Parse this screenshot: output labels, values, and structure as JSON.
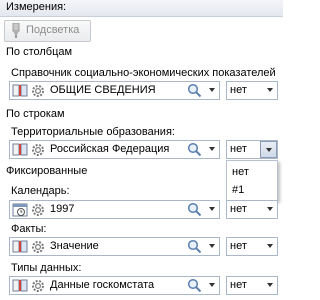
{
  "panel": {
    "title": "Измерения:"
  },
  "toolbar": {
    "highlight_label": "Подсветка"
  },
  "columns": {
    "title": "По столбцам",
    "items": [
      {
        "label": "Справочник социально-экономических показателей",
        "value": "ОБЩИЕ СВЕДЕНИЯ",
        "option": "нет"
      }
    ]
  },
  "rows": {
    "title": "По строкам",
    "items": [
      {
        "label": "Территориальные образования:",
        "value": "Российская Федерация",
        "option": "нет"
      }
    ]
  },
  "option_dropdown": {
    "options": [
      "нет",
      "#1"
    ]
  },
  "fixed": {
    "title": "Фиксированные",
    "items": [
      {
        "label": "Календарь:",
        "value": "1997",
        "option": "нет"
      },
      {
        "label": "Факты:",
        "value": "Значение",
        "option": "нет"
      },
      {
        "label": "Типы данных:",
        "value": "Данные госкомстата",
        "option": "нет"
      }
    ]
  },
  "icons": {
    "book": "book-icon",
    "gear": "gear-icon",
    "search": "magnifier-icon",
    "calendar": "calendar-icon",
    "dropdown": "chevron-down-icon",
    "highlight": "highlighter-icon"
  },
  "colors": {
    "border": "#a9b7c9",
    "disabled_text": "#8c8c8c",
    "header_bg": "#e3e7ee"
  }
}
